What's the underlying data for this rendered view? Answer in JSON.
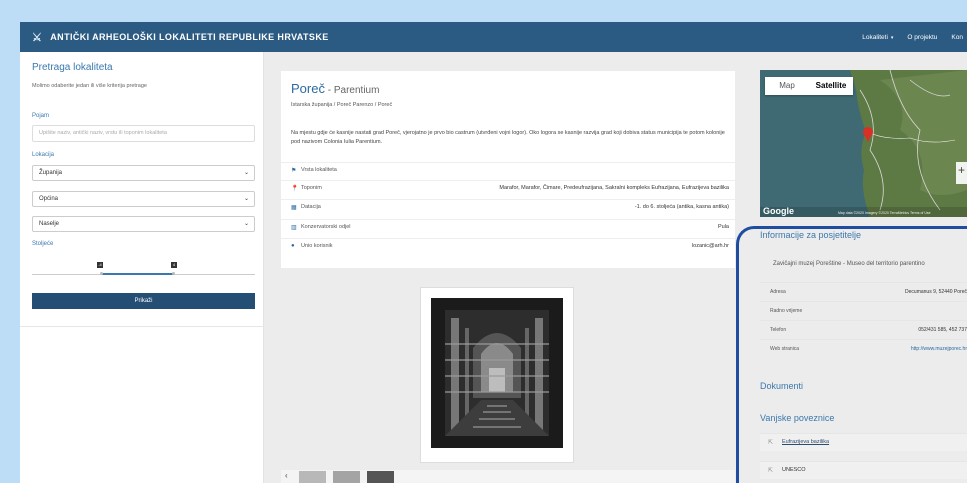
{
  "topbar": {
    "title": "ANTIČKI ARHEOLOŠKI LOKALITETI REPUBLIKE HRVATSKE",
    "nav": [
      {
        "label": "Lokaliteti",
        "caret": "▾"
      },
      {
        "label": "O projektu"
      },
      {
        "label": "Kon"
      }
    ]
  },
  "sidebar": {
    "title": "Pretraga lokaliteta",
    "subtitle": "Molimo odaberite jedan ili više kriterija pretrage",
    "pojam_label": "Pojam",
    "pojam_placeholder": "Upišite naziv, antički naziv, vrstu ili toponim lokaliteta",
    "lokacija_label": "Lokacija",
    "selects": [
      "Županija",
      "Općina",
      "Naselje"
    ],
    "stoljece_label": "Stoljeće",
    "slider": {
      "from_label": "-4",
      "to_label": "4",
      "from_fraction": 0.31,
      "to_fraction": 0.64
    },
    "button": "Prikaži"
  },
  "site": {
    "name": "Poreč",
    "ancient_name": " - Parentium",
    "breadcrumb": "Istarska županija / Poreč Parenzo / Poreč",
    "description": "Na mjestu gdje će kasnije nastati grad Poreč, vjerojatno je prvo bio castrum (utvrđeni vojni logor). Oko logora se kasnije razvija grad koji dobiva status municipija te potom kolonije pod nazivom Colonia Iulia Parentium.",
    "attributes": [
      {
        "icon": "flag-icon",
        "glyph": "⚑",
        "label": "Vrsta lokaliteta",
        "value": ""
      },
      {
        "icon": "map-marker-icon",
        "glyph": "⬤",
        "label": "Toponim",
        "value": "Marafor, Marafor, Čimare, Predeufrazijana, Sakralni kompleks Eufrazijana, Eufrazijeva bazilika"
      },
      {
        "icon": "calendar-icon",
        "glyph": "▦",
        "label": "Datacija",
        "value": "-1. do 6. stoljeća (antika, kasna antika)"
      },
      {
        "icon": "institution-icon",
        "glyph": "▥",
        "label": "Konzervatorski odjel",
        "value": "Pula"
      },
      {
        "icon": "user-icon",
        "glyph": "●",
        "label": "Unio korisnik",
        "value": "lozanic@arh.hr"
      }
    ]
  },
  "map": {
    "tab_map": "Map",
    "tab_satellite": "Satellite",
    "google": "Google",
    "attribution": "Map data ©2020 Imagery ©2020 TerraMetrics Terms of Use",
    "zoom": "+"
  },
  "visitor": {
    "heading": "Informacije za posjetitelje",
    "museum": "Zavičajni muzej Poreštine - Museo del territorio parentino",
    "rows": [
      {
        "k": "Adresa",
        "v": "Decumanus 9, 52440 Poreč",
        "link": false
      },
      {
        "k": "Radno vrijeme",
        "v": "",
        "link": false
      },
      {
        "k": "Telefon",
        "v": "052/431 585, 452 737",
        "link": false
      },
      {
        "k": "Web stranica",
        "v": "http://www.muzejporec.hr",
        "link": true
      }
    ]
  },
  "dokumenti": "Dokumenti",
  "vanjske": {
    "heading": "Vanjske poveznice",
    "links": [
      "Eufrazijeva bazilika",
      "UNESCO"
    ]
  },
  "thumb_nav": "‹"
}
